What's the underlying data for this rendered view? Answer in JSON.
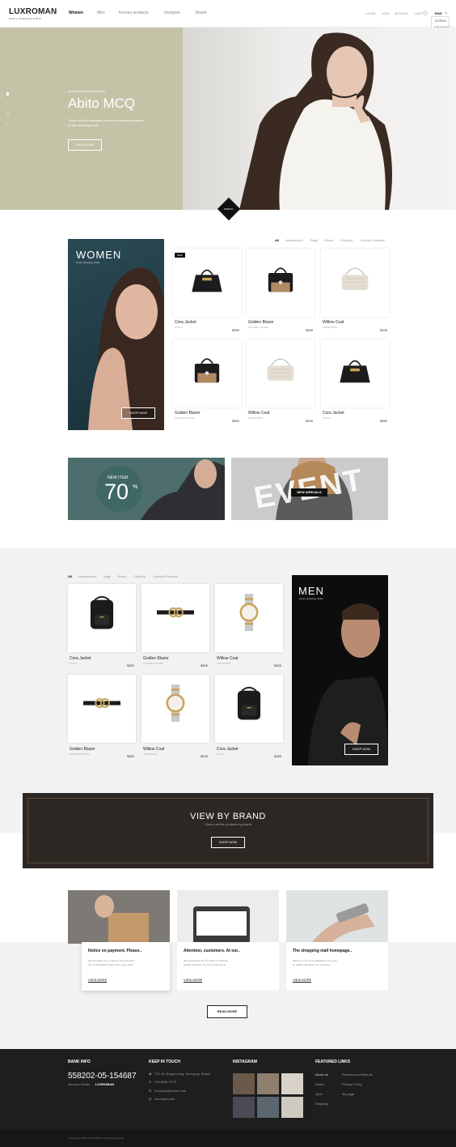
{
  "header": {
    "logo": "LUXROMAN",
    "logo_sub": "luxury shopping online",
    "nav": [
      "Women",
      "Men",
      "Korean products",
      "Designer",
      "Board"
    ],
    "util": [
      "LOGIN",
      "JOIN",
      "MYPAGE",
      "CART",
      "0"
    ],
    "lang": {
      "current": "ENG",
      "options": [
        "KOREA",
        "VIETNAM"
      ]
    }
  },
  "hero": {
    "eyebrow": "ALEXANDER MCQUEEN",
    "title": "Abito MCQ",
    "desc1": "Check out the cheapest and most luxurious products",
    "desc2": "at this shopping mall",
    "cta": "SHOP NOW",
    "pager": [
      "01",
      "02",
      "03",
      "04"
    ],
    "scroll_label": "SCROLL"
  },
  "women": {
    "title": "WOMEN",
    "sub": "luxury shopping online",
    "cta": "SHOP NOW",
    "badge": "NEW",
    "tabs": [
      "All",
      "Accessories",
      "Bags",
      "Shoes",
      "Clothing",
      "Korean Products"
    ],
    "products": [
      {
        "name": "Cora Jacket",
        "brand": "GUCCI",
        "price": "$250"
      },
      {
        "name": "Golden Blazer",
        "brand": "GOLDEN GOOSE",
        "price": "$300"
      },
      {
        "name": "Willow Coat",
        "brand": "SAMSONITE",
        "price": "$100"
      },
      {
        "name": "Golden Blazer",
        "brand": "GOLDEN GOOSE",
        "price": "$300"
      },
      {
        "name": "Willow Coat",
        "brand": "SAMSONITE",
        "price": "$100"
      },
      {
        "name": "Cora Jacket",
        "brand": "GUCCI",
        "price": "$250"
      }
    ]
  },
  "promo": {
    "new_item": "NEW ITEM",
    "percent": "70",
    "percent_sign": "%",
    "event": "EVENT",
    "arrivals": "NEW ARRIVALS"
  },
  "men": {
    "title": "MEN",
    "sub": "luxury shopping online",
    "cta": "SHOP NOW",
    "tabs": [
      "All",
      "Accessories",
      "Bags",
      "Shoes",
      "Clothing",
      "Korean Products"
    ],
    "products": [
      {
        "name": "Cora Jacket",
        "brand": "GUCCI",
        "price": "$250"
      },
      {
        "name": "Golden Blazer",
        "brand": "GOLDEN GOOSE",
        "price": "$300"
      },
      {
        "name": "Willow Coat",
        "brand": "SAMSONITE",
        "price": "$100"
      },
      {
        "name": "Golden Blazer",
        "brand": "GOLDEN GOOSE",
        "price": "$300"
      },
      {
        "name": "Willow Coat",
        "brand": "SAMSONITE",
        "price": "$100"
      },
      {
        "name": "Cora Jacket",
        "brand": "GUCCI",
        "price": "$250"
      }
    ]
  },
  "brand": {
    "title": "VIEW BY BRAND",
    "sub": "Check out the products by brand",
    "cta": "SHOP NOW"
  },
  "notices": [
    {
      "title": "Notice on payment. Please..",
      "body1": "We will guide you on delivery and payment.",
      "body2": "Our LUXROMAN makes sure to pay cash...",
      "cta": "VIEW MORE"
    },
    {
      "title": "Attention, customers. At our..",
      "body1": "We will operate the CS center for delivery",
      "body2": "related problems. So, if you need some...",
      "cta": "VIEW MORE"
    },
    {
      "title": "The shopping mall homepage..",
      "body1": "We'll try to get more satisfaction from you",
      "body2": "by quickly updating more products...",
      "cta": "VIEW MORE"
    }
  ],
  "read_more": "READ MORE",
  "footer": {
    "bank_title": "BANK INFO",
    "bank_no": "558202-05-154687",
    "holder_label": "Account Holder :",
    "holder": "LUXROMAN",
    "keep_title": "KEEP IN TOUCH",
    "contacts": [
      "372-15, Bugok-dong, Seong-gu, Busan",
      "070-8281-3776",
      "hoodepta@naver.com",
      "luxroman.com"
    ],
    "insta_title": "INSTAGRAM",
    "links_title": "FEATURED LINKS",
    "links": [
      "About us",
      "Returns and Refunds",
      "Notice",
      "Privacy Policy",
      "Q&A",
      "My page",
      "Shipping"
    ],
    "copyright": "Copyright © 2019 LUXROMAN. All Rights Reserved."
  },
  "colors": {
    "hero_bg": "#c5c3a7",
    "promo_teal": "#4d6e6c",
    "brand_bg": "#2d2723",
    "footer": "#1e1e1e"
  }
}
